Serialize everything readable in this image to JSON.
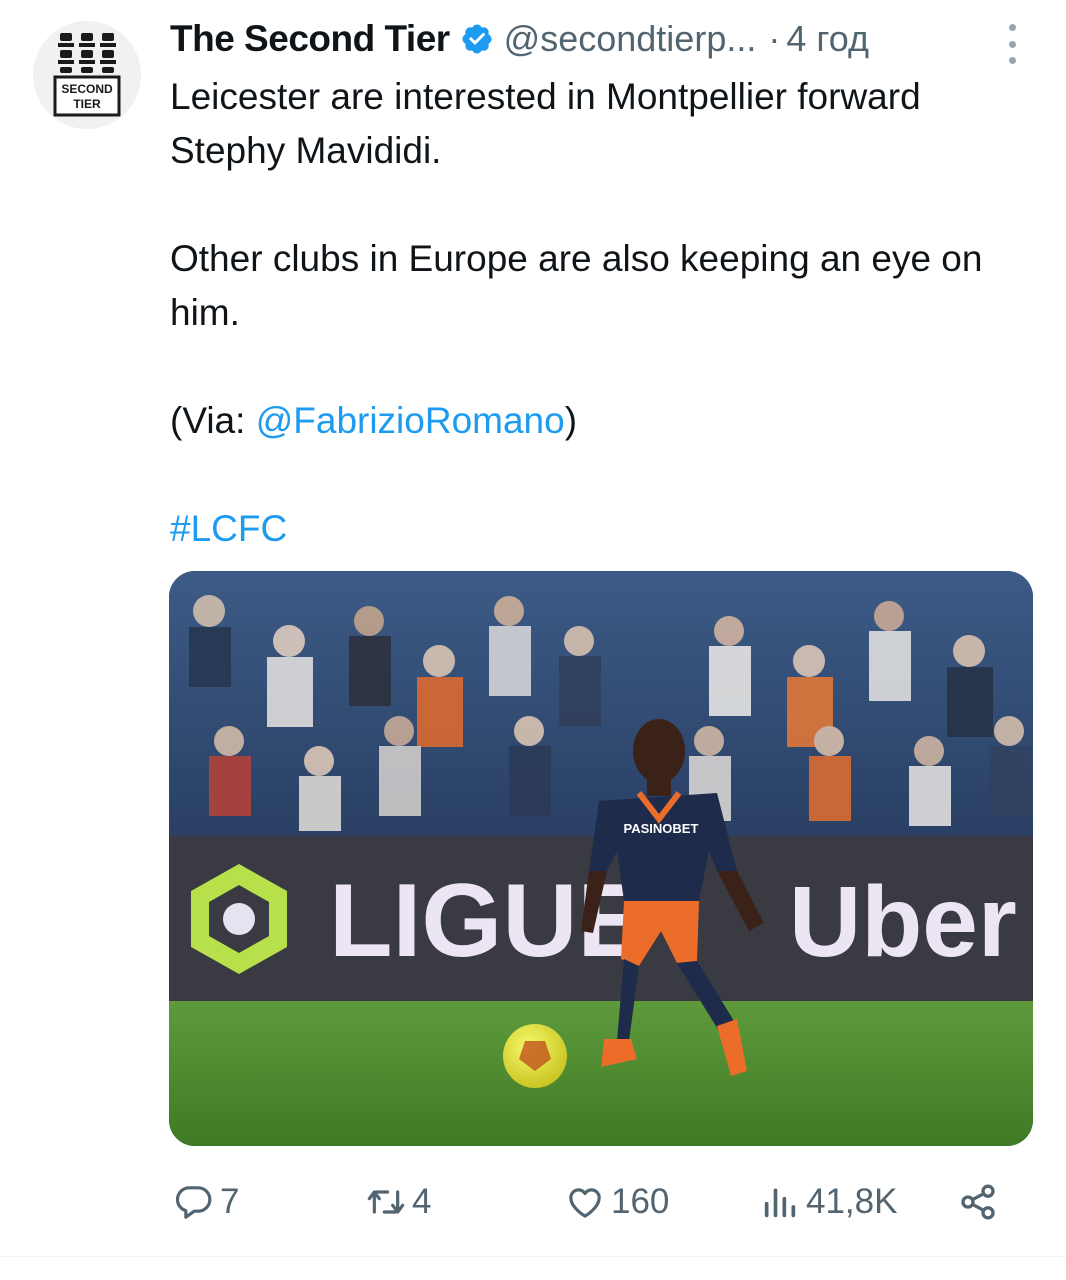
{
  "author": {
    "name": "The Second Tier",
    "handle": "@secondtierp...",
    "separator": "·",
    "time": "4 год",
    "logo_text_1": "SECOND",
    "logo_text_2": "TIER"
  },
  "tweet": {
    "line1": "Leicester are interested in Montpellier forward Stephy Mavididi.",
    "line2": "Other clubs in Europe are also keeping an eye on him.",
    "via_prefix": "(Via: ",
    "via_link": "@FabrizioRomano",
    "via_suffix": ")",
    "hashtag": "#LCFC"
  },
  "media": {
    "board_text_1": "LIGUE",
    "board_text_2": "Uber",
    "shirt_sponsor": "PASINOBET"
  },
  "actions": {
    "replies": "7",
    "retweets": "4",
    "likes": "160",
    "views": "41,8K"
  },
  "icons": {
    "verified": "verified-badge-icon",
    "more": "more-options-icon",
    "reply": "reply-icon",
    "retweet": "retweet-icon",
    "like": "heart-icon",
    "views": "views-chart-icon",
    "share": "share-icon"
  },
  "colors": {
    "link": "#1d9bf0",
    "muted": "#536471",
    "text": "#0f1419"
  }
}
